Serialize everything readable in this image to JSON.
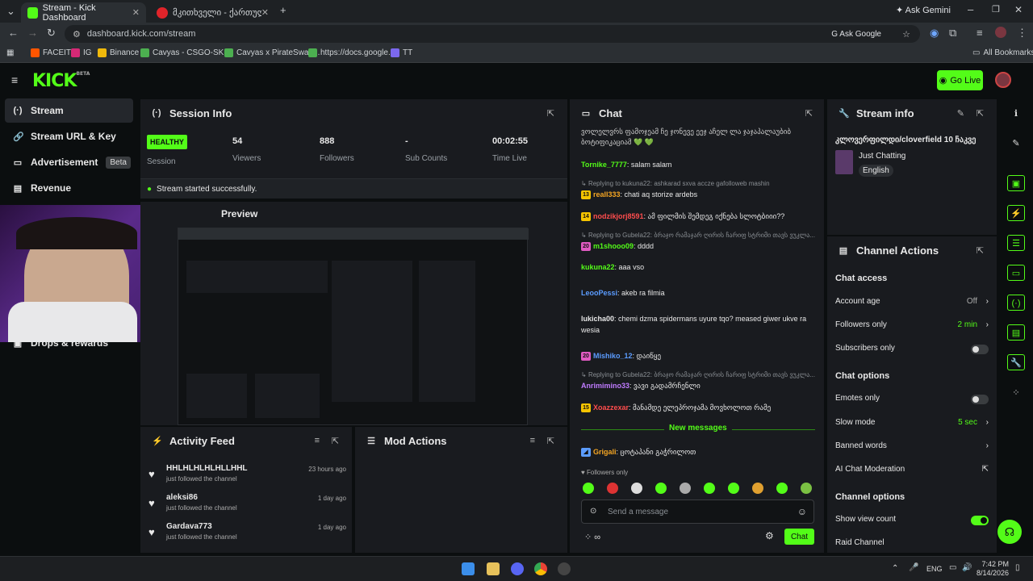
{
  "browser": {
    "tabs": [
      {
        "title": "Stream - Kick Dashboard",
        "active": true
      },
      {
        "title": "მკითხველი - ქართულად |",
        "active": false
      }
    ],
    "ask_gemini": "Ask Gemini",
    "url": "dashboard.kick.com/stream",
    "ask_google": "Ask Google",
    "bookmarks": [
      "FACEIT",
      "IG",
      "Binance",
      "Cavyas - CSGO-SKI...",
      "Cavyas x PirateSwap...",
      "https://docs.google....",
      "TT"
    ],
    "all_bookmarks": "All Bookmarks"
  },
  "topnav": {
    "logo": "KICK",
    "logo_badge": "BETA",
    "go_live": "Go Live"
  },
  "sidebar": {
    "items": [
      {
        "label": "Stream",
        "icon": "broadcast-icon",
        "active": true
      },
      {
        "label": "Stream URL & Key",
        "icon": "link-icon"
      },
      {
        "label": "Advertisement",
        "icon": "ad-icon",
        "badge": "Beta"
      },
      {
        "label": "Revenue",
        "icon": "chart-icon"
      },
      {
        "label": "Drops & rewards",
        "icon": "gift-icon"
      }
    ]
  },
  "session": {
    "title": "Session Info",
    "status": "HEALTHY",
    "stats": [
      {
        "value": "",
        "label": "Session"
      },
      {
        "value": "54",
        "label": "Viewers"
      },
      {
        "value": "888",
        "label": "Followers"
      },
      {
        "value": "-",
        "label": "Sub Counts"
      },
      {
        "value": "00:02:55",
        "label": "Time Live"
      }
    ],
    "notice": "Stream started successfully.",
    "preview_title": "Preview"
  },
  "activity": {
    "title": "Activity Feed",
    "items": [
      {
        "name": "HHLHLHLHLHLLHHL",
        "action": "just followed the channel",
        "time": "23 hours ago"
      },
      {
        "name": "aleksi86",
        "action": "just followed the channel",
        "time": "1 day ago"
      },
      {
        "name": "Gardava773",
        "action": "just followed the channel",
        "time": "1 day ago"
      }
    ]
  },
  "mod_actions": {
    "title": "Mod Actions"
  },
  "chat": {
    "title": "Chat",
    "top_fragment": "ვოლელვრს ფამოჯეამ ჩე ჯონევე ეეჯ აჩელ ლა ჯაჯაპალაუბიბ",
    "top_fragment2": "ბოტიფიკაციამ 💚 💚",
    "messages": [
      {
        "user": "Tornike_7777",
        "color": "#53fc18",
        "text": "salam salam"
      },
      {
        "reply": "Replying to kukuna22: ashkarad sxva accze gafolloweb mashin",
        "badge": "13",
        "badge_color": "#f5c400",
        "user": "reall333",
        "color": "#f5a623",
        "text": "chati aq storize ardebs"
      },
      {
        "badge": "14",
        "badge_color": "#f5c400",
        "user": "nodzikjorj8591",
        "color": "#ff4d4d",
        "text": "ამ ფილმის შემდეგ იქნება სლოტბიიი??"
      },
      {
        "reply": "Replying to Gubela22: ბრაჯო რამაჯარ ღირის ჩარიფ სტრიმი თავს ვუკლა...",
        "badge": "20",
        "badge_color": "#e05bc2",
        "user": "m1shooo09",
        "color": "#53fc18",
        "text": "dddd"
      },
      {
        "user": "kukuna22",
        "color": "#53fc18",
        "text": "aaa vso"
      },
      {
        "user": "LeooPessi",
        "color": "#5b9cff",
        "text": "akeb ra filmia"
      },
      {
        "user": "lukicha00",
        "color": "#e8e8e8",
        "text": "chemi dzma spidermans uyure tqo? meased giwer ukve ra wesia"
      },
      {
        "badge": "20",
        "badge_color": "#e05bc2",
        "user": "Mishiko_12",
        "color": "#5b9cff",
        "text": "დაიწყე"
      },
      {
        "reply": "Replying to Gubela22: ბრაჯო რამაჯარ ღირის ჩარიფ სტრიმი თავს ვუკლა...",
        "user": "Anrimimino33",
        "color": "#c07bff",
        "text": "ვავი გადამრჩენლი"
      },
      {
        "badge": "15",
        "badge_color": "#f5c400",
        "user": "Xoazzexar",
        "color": "#ff4d4d",
        "text": "მანამდე ელეპროჯამა მოვხოლოთ რამე"
      },
      {
        "user": "Grigali",
        "color": "#f5a623",
        "text": "ცოტაპანი გაჭრილოთ"
      }
    ],
    "new_messages": "New messages",
    "followers_only": "Followers only",
    "input_placeholder": "Send a message",
    "send_label": "Chat",
    "infinity": "∞"
  },
  "stream_info": {
    "title": "Stream info",
    "stream_title": "კლოვერფილდი/cloverfield 10 ჩაკვე",
    "category": "Just Chatting",
    "tag": "English"
  },
  "channel_actions": {
    "title": "Channel Actions",
    "chat_access": "Chat access",
    "account_age": {
      "label": "Account age",
      "value": "Off"
    },
    "followers_only": {
      "label": "Followers only",
      "value": "2 min"
    },
    "subscribers_only": {
      "label": "Subscribers only",
      "on": false
    },
    "chat_options": "Chat options",
    "emotes_only": {
      "label": "Emotes only",
      "on": false
    },
    "slow_mode": {
      "label": "Slow mode",
      "value": "5 sec"
    },
    "banned_words": {
      "label": "Banned words"
    },
    "ai_moderation": {
      "label": "AI Chat Moderation"
    },
    "channel_options": "Channel options",
    "show_view_count": {
      "label": "Show view count",
      "on": true
    },
    "raid_channel": {
      "label": "Raid Channel"
    }
  },
  "taskbar": {
    "lang": "ENG",
    "time": "7:42 PM",
    "date": "8/14/2026"
  },
  "colors": {
    "accent": "#53fc18",
    "panel": "#191b1f",
    "bg": "#0b0e0f"
  }
}
